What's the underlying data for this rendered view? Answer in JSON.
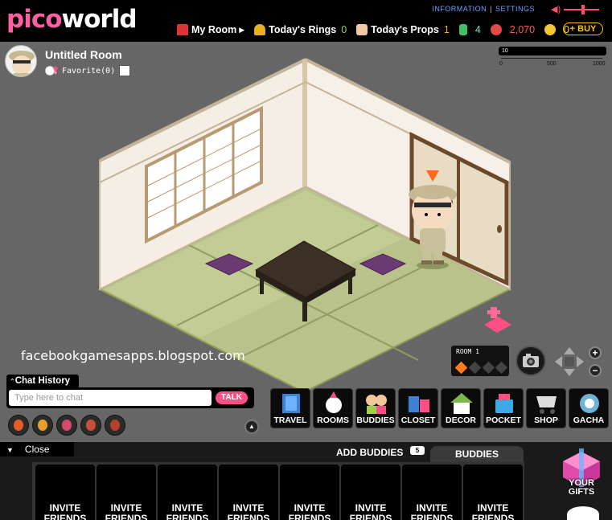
{
  "logo": {
    "part1": "pico",
    "part2": "world"
  },
  "toplinks": {
    "information": "INFORMATION",
    "settings": "SETTINGS"
  },
  "nav": {
    "my_room": "My Room",
    "todays_rings_label": "Today's Rings",
    "todays_rings_value": "0",
    "todays_props_label": "Today's Props",
    "todays_props_value": "1",
    "bottles": "4",
    "coins": "2,070",
    "gold": "0",
    "buy": "+ BUY"
  },
  "room": {
    "title": "Untitled Room",
    "favorite": "Favorite(0)",
    "meter_value": "10",
    "meter_ticks": [
      "0",
      "500",
      "1000"
    ],
    "panel_label": "ROOM 1"
  },
  "watermark": "facebookgamesapps.blogspot.com",
  "chat": {
    "history_label": "Chat History",
    "placeholder": "Type here to chat",
    "talk": "TALK",
    "scroll_icon": "▲"
  },
  "toolbar": [
    {
      "label": "TRAVEL"
    },
    {
      "label": "ROOMS"
    },
    {
      "label": "BUDDIES"
    },
    {
      "label": "CLOSET"
    },
    {
      "label": "DECOR"
    },
    {
      "label": "POCKET"
    },
    {
      "label": "SHOP"
    },
    {
      "label": "GACHA"
    }
  ],
  "zoom": {
    "plus": "+",
    "minus": "−"
  },
  "bottom": {
    "close": "Close",
    "close_icon": "▼",
    "add_buddies": "ADD BUDDIES",
    "add_count": "5",
    "buddies_tab": "BUDDIES",
    "invite_lines": [
      "INVITE",
      "FRIENDS"
    ],
    "gifts_lines": [
      "YOUR",
      "GIFTS"
    ]
  },
  "colors": {
    "accent_pink": "#ff5fa2",
    "buy_gold": "#ffc700",
    "link_blue": "#6fa0ff",
    "talk_pink": "#ff4f84"
  }
}
